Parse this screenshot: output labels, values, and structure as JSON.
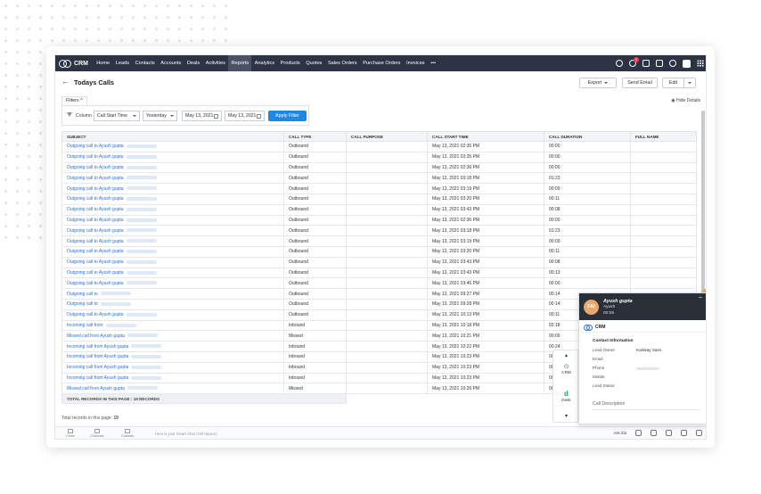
{
  "topnav": {
    "logo": "CRM",
    "items": [
      "Home",
      "Leads",
      "Contacts",
      "Accounts",
      "Deals",
      "Activities",
      "Reports",
      "Analytics",
      "Products",
      "Quotes",
      "Sales Orders",
      "Purchase Orders",
      "Invoices",
      "•••"
    ],
    "active": "Reports",
    "notification_count": "1"
  },
  "page": {
    "back_icon": "←",
    "title": "Todays Calls",
    "export_label": "Export",
    "send_email_label": "Send Email",
    "edit_label": "Edit"
  },
  "filters": {
    "tab_label": "Filters ^",
    "column_label": "Column",
    "column_value": "Call Start Time",
    "period_value": "Yesterday",
    "date_from": "May 13, 2021",
    "date_to": "May 13, 2021",
    "apply_label": "Apply Filter",
    "hide_details": "Hide Details"
  },
  "table": {
    "headers": [
      "SUBJECT",
      "CALL TYPE",
      "CALL PURPOSE",
      "CALL START TIME",
      "CALL DURATION",
      "FULL NAME"
    ],
    "rows": [
      [
        "Outgoing call to Ayush gupta",
        "Outbound",
        "",
        "May 13, 2021 02:35 PM",
        "00:00",
        ""
      ],
      [
        "Outgoing call to Ayush gupta",
        "Outbound",
        "",
        "May 13, 2021 02:35 PM",
        "00:00",
        ""
      ],
      [
        "Outgoing call to Ayush gupta",
        "Outbound",
        "",
        "May 13, 2021 02:36 PM",
        "00:00",
        ""
      ],
      [
        "Outgoing call to Ayush gupta",
        "Outbound",
        "",
        "May 13, 2021 03:18 PM",
        "01:23",
        ""
      ],
      [
        "Outgoing call to Ayush gupta",
        "Outbound",
        "",
        "May 13, 2021 03:19 PM",
        "00:09",
        ""
      ],
      [
        "Outgoing call to Ayush gupta",
        "Outbound",
        "",
        "May 13, 2021 03:20 PM",
        "00:11",
        ""
      ],
      [
        "Outgoing call to Ayush gupta",
        "Outbound",
        "",
        "May 13, 2021 03:43 PM",
        "00:08",
        ""
      ],
      [
        "Outgoing call to Ayush gupta",
        "Outbound",
        "",
        "May 13, 2021 02:36 PM",
        "00:00",
        ""
      ],
      [
        "Outgoing call to Ayush gupta",
        "Outbound",
        "",
        "May 13, 2021 03:18 PM",
        "01:23",
        ""
      ],
      [
        "Outgoing call to Ayush gupta",
        "Outbound",
        "",
        "May 13, 2021 03:19 PM",
        "00:09",
        ""
      ],
      [
        "Outgoing call to Ayush gupta",
        "Outbound",
        "",
        "May 13, 2021 03:20 PM",
        "00:11",
        ""
      ],
      [
        "Outgoing call to Ayush gupta",
        "Outbound",
        "",
        "May 13, 2021 03:43 PM",
        "00:08",
        ""
      ],
      [
        "Outgoing call to Ayush gupta",
        "Outbound",
        "",
        "May 13, 2021 03:43 PM",
        "00:13",
        ""
      ],
      [
        "Outgoing call to Ayush gupta",
        "Outbound",
        "",
        "May 13, 2021 03:46 PM",
        "00:00",
        ""
      ],
      [
        "Outgoing call to",
        "Outbound",
        "",
        "May 13, 2021 09:27 PM",
        "00:14",
        ""
      ],
      [
        "Outgoing call to",
        "Outbound",
        "",
        "May 13, 2021 09:28 PM",
        "00:14",
        ""
      ],
      [
        "Outgoing call to Ayush gupta",
        "Outbound",
        "",
        "May 13, 2021 10:13 PM",
        "00:11",
        ""
      ],
      [
        "Incoming call from",
        "Inbound",
        "",
        "May 13, 2021 10:18 PM",
        "02:18",
        ""
      ],
      [
        "Missed call from Ayush gupta",
        "Missed",
        "",
        "May 13, 2021 10:21 PM",
        "00:00",
        ""
      ],
      [
        "Incoming call from Ayush gupta",
        "Inbound",
        "",
        "May 13, 2021 10:22 PM",
        "00:24",
        ""
      ],
      [
        "Incoming call from Ayush gupta",
        "Inbound",
        "",
        "May 13, 2021 10:23 PM",
        "00:09",
        ""
      ],
      [
        "Incoming call from Ayush gupta",
        "Inbound",
        "",
        "May 13, 2021 10:23 PM",
        "00:03",
        ""
      ],
      [
        "Incoming call from Ayush gupta",
        "Inbound",
        "",
        "May 13, 2021 10:23 PM",
        "00:10",
        ""
      ],
      [
        "Missed call from Ayush gupta",
        "Missed",
        "",
        "May 13, 2021 10:26 PM",
        "00:00",
        ""
      ]
    ],
    "total_label": "TOTAL RECORDS IN THIS PAGE : 19 RECORDS",
    "total_footer_prefix": "Total records in this page:",
    "total_footer_count": "19"
  },
  "bottombar": {
    "items": [
      "Chats",
      "Channels",
      "Contacts"
    ],
    "message": "Here is your Smart Chat (Ctrl+Space)",
    "zia": "Ask Zia"
  },
  "side_widgets": {
    "crm": "CRM",
    "desk": "Desk"
  },
  "call_panel": {
    "avatar_initials": "FAI",
    "name": "Ayush gupta",
    "sub": "Ayush",
    "time": "00:08",
    "minimize": "–",
    "crm_label": "CRM",
    "contact_info_title": "Contact Information",
    "lead_owner_label": "Lead Owner",
    "lead_owner_value": "Kartikay Saini",
    "email_label": "Email",
    "phone_label": "Phone",
    "mobile_label": "Mobile",
    "lead_status_label": "Lead Status",
    "call_description": "Call Description"
  },
  "colors": {
    "nav_bg": "#2b3345",
    "link": "#2c6fd6",
    "apply": "#1e88e5",
    "panel_dark": "#2b2f38"
  }
}
